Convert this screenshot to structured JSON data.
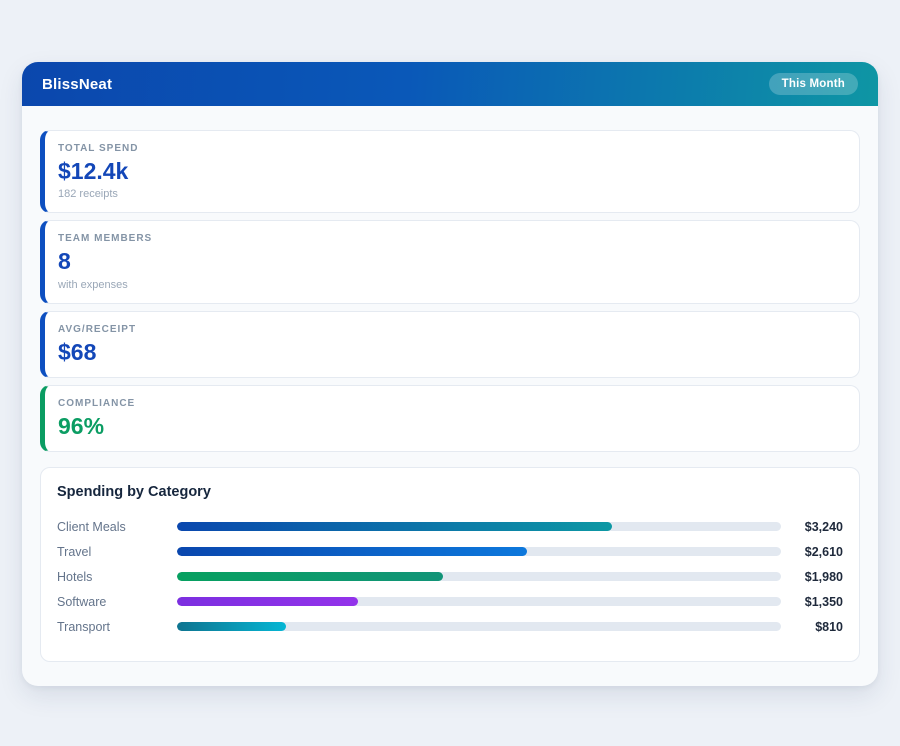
{
  "header": {
    "app_title": "BlissNeat",
    "period_badge": "This Month",
    "gradient_start": "#0b47ad",
    "gradient_end": "#0e96a4"
  },
  "stats": [
    {
      "label": "TOTAL SPEND",
      "value": "$12.4k",
      "sub": "182 receipts",
      "accent": "#0d4fc0",
      "value_color": "#1347b8"
    },
    {
      "label": "TEAM MEMBERS",
      "value": "8",
      "sub": "with expenses",
      "accent": "#0d4fc0",
      "value_color": "#1347b8"
    },
    {
      "label": "AVG/RECEIPT",
      "value": "$68",
      "sub": "",
      "accent": "#0d4fc0",
      "value_color": "#1347b8"
    },
    {
      "label": "COMPLIANCE",
      "value": "96%",
      "sub": "",
      "accent": "#0a9c62",
      "value_color": "#0b9d63"
    }
  ],
  "chart_data": {
    "type": "bar",
    "title": "Spending by Category",
    "orientation": "horizontal",
    "categories": [
      "Client Meals",
      "Travel",
      "Hotels",
      "Software",
      "Transport"
    ],
    "values": [
      3240,
      2610,
      1980,
      1350,
      810
    ],
    "value_labels": [
      "$3,240",
      "$2,610",
      "$1,980",
      "$1,350",
      "$810"
    ],
    "xlim": [
      0,
      4500
    ],
    "track_color": "#e2e8f0",
    "bar_gradients": [
      [
        "#0a47ae",
        "#0d98a4"
      ],
      [
        "#0a47ae",
        "#0d78dc"
      ],
      [
        "#07a060",
        "#129478"
      ],
      [
        "#7c2fe0",
        "#9333ea"
      ],
      [
        "#0e7490",
        "#06b6d4"
      ]
    ]
  }
}
